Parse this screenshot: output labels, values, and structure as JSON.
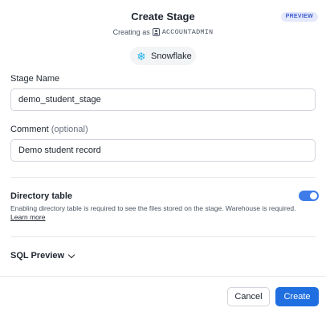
{
  "dialog": {
    "title": "Create Stage",
    "badge": "PREVIEW",
    "creating_as_prefix": "Creating as",
    "role": "ACCOUNTADMIN",
    "provider_label": "Snowflake",
    "provider_icon": "snowflake-icon",
    "accent": "#1f6fe0"
  },
  "form": {
    "stage_name_label": "Stage Name",
    "stage_name_value": "demo_student_stage",
    "comment_label": "Comment",
    "comment_optional": "(optional)",
    "comment_value": "Demo student record"
  },
  "directory": {
    "title": "Directory table",
    "description": "Enabling directory table is required to see the files stored on the stage. Warehouse is required.",
    "learn_more": "Learn more",
    "enabled": true
  },
  "sql_preview": {
    "label": "SQL Preview"
  },
  "footer": {
    "cancel_label": "Cancel",
    "create_label": "Create"
  }
}
